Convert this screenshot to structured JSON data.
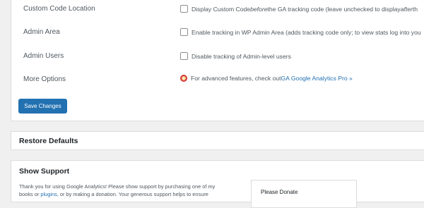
{
  "settings": {
    "rows": [
      {
        "label": "Custom Code Location",
        "text_before": "Display Custom Code ",
        "text_em": "before",
        "text_middle": " the GA tracking code (leave unchecked to display ",
        "text_em2": "after",
        "text_after": " th"
      },
      {
        "label": "Admin Area",
        "text": "Enable tracking in WP Admin Area (adds tracking code only; to view stats log into you"
      },
      {
        "label": "Admin Users",
        "text": "Disable tracking of Admin-level users"
      },
      {
        "label": "More Options",
        "text_prefix": "For advanced features, check out ",
        "link_text": "GA Google Analytics Pro »"
      }
    ],
    "save_label": "Save Changes"
  },
  "restore": {
    "title": "Restore Defaults"
  },
  "support": {
    "title": "Show Support",
    "line1_prefix": "Thank you for using Google Analytics! Please show support by purchasing one of my",
    "line2_prefix": "books or ",
    "line2_link": "plugins",
    "line2_suffix": ", or by making a donation. Your generous support helps to ensure",
    "donate_title": "Please Donate"
  },
  "colors": {
    "accent": "#2271b1",
    "ring_outer": "#d63638",
    "ring_inner": "#f0b849"
  }
}
